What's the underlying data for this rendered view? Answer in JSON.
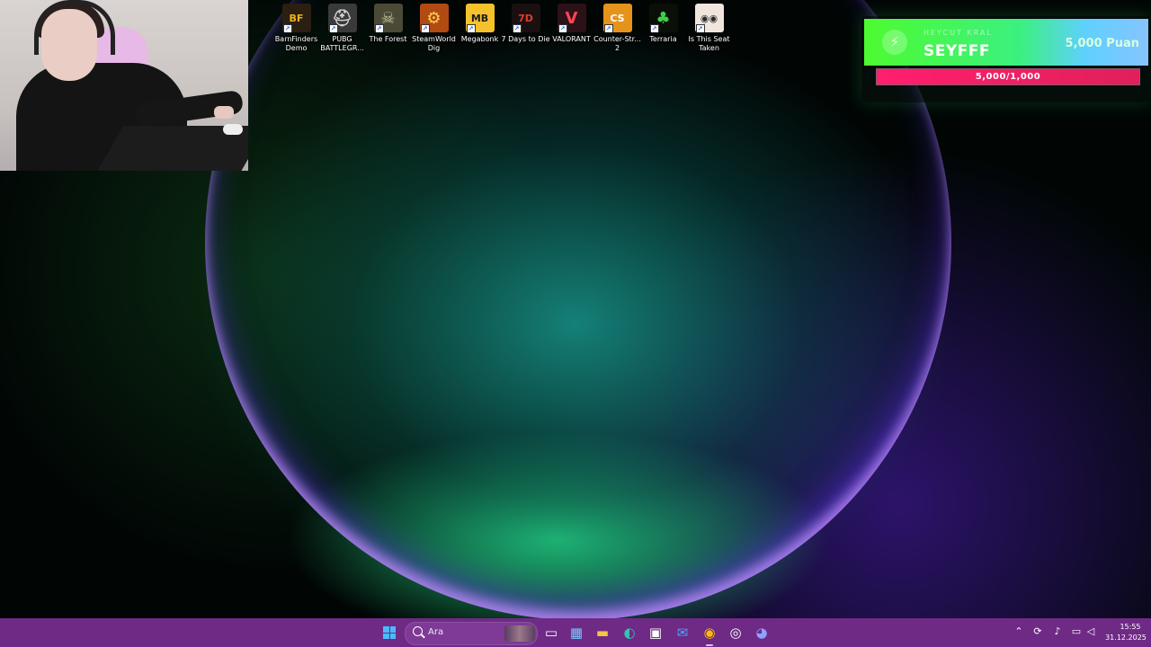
{
  "desktop": {
    "icons": [
      {
        "label": "BarnFinders Demo",
        "icon": "barnfinders-icon",
        "glyph": "BF",
        "color": "#f3b21b",
        "bg": "#2a1f10"
      },
      {
        "label": "PUBG BATTLEGR...",
        "icon": "pubg-helmet-icon",
        "glyph": "⛑",
        "color": "#d0d0d0",
        "bg": "#3a3a3a"
      },
      {
        "label": "The Forest",
        "icon": "the-forest-icon",
        "glyph": "☠",
        "color": "#c9c2a0",
        "bg": "#4b4a36"
      },
      {
        "label": "SteamWorld Dig",
        "icon": "steamworld-dig-icon",
        "glyph": "⚙",
        "color": "#ffd44a",
        "bg": "#b24a14"
      },
      {
        "label": "Megabonk",
        "icon": "megabonk-icon",
        "glyph": "MB",
        "color": "#1a1a1a",
        "bg": "#f6c22c"
      },
      {
        "label": "7 Days to Die",
        "icon": "7-days-to-die-icon",
        "glyph": "7D",
        "color": "#e23b2b",
        "bg": "#1a1010"
      },
      {
        "label": "VALORANT",
        "icon": "valorant-icon",
        "glyph": "V",
        "color": "#ff4655",
        "bg": "#2d1118"
      },
      {
        "label": "Counter-Str... 2",
        "icon": "counter-strike-icon",
        "glyph": "CS",
        "color": "#ffffff",
        "bg": "#e6931b"
      },
      {
        "label": "Terraria",
        "icon": "terraria-tree-icon",
        "glyph": "♣",
        "color": "#3fcf4a",
        "bg": "#0a0f08"
      },
      {
        "label": "Is This Seat Taken",
        "icon": "is-this-seat-taken-icon",
        "glyph": "◉◉",
        "color": "#2a2a2a",
        "bg": "#f1e6de"
      }
    ]
  },
  "stream_widget": {
    "subtitle": "HEYCUT KRAL",
    "username": "SEYFFF",
    "points": "5,000 Puan",
    "progress_text": "5,000/1,000",
    "progress_fraction": 1.0,
    "banner_color": "#4dfb30",
    "bar_color": "#ff1f6e"
  },
  "taskbar": {
    "search_placeholder": "Ara",
    "apps": [
      {
        "name": "task-view-button",
        "icon": "task-view-icon",
        "glyph": "▭",
        "color": "#ffffff"
      },
      {
        "name": "widgets-button",
        "icon": "widgets-icon",
        "glyph": "▦",
        "color": "#7cc6ff"
      },
      {
        "name": "file-explorer-button",
        "icon": "folder-icon",
        "glyph": "▬",
        "color": "#f6c544"
      },
      {
        "name": "edge-button",
        "icon": "edge-icon",
        "glyph": "◐",
        "color": "#33c3ae"
      },
      {
        "name": "store-button",
        "icon": "store-bag-icon",
        "glyph": "▣",
        "color": "#ffffff"
      },
      {
        "name": "mail-button",
        "icon": "mail-icon",
        "glyph": "✉",
        "color": "#4aa3ff"
      },
      {
        "name": "chrome-button",
        "icon": "chrome-icon",
        "glyph": "◉",
        "color": "#fbbc05"
      },
      {
        "name": "obs-button",
        "icon": "obs-icon",
        "glyph": "◎",
        "color": "#ffffff"
      },
      {
        "name": "discord-button",
        "icon": "discord-icon",
        "glyph": "◕",
        "color": "#8da2ff"
      }
    ],
    "active_app": "chrome-button"
  },
  "tray": {
    "time": "15:55",
    "date": "31.12.2025"
  }
}
